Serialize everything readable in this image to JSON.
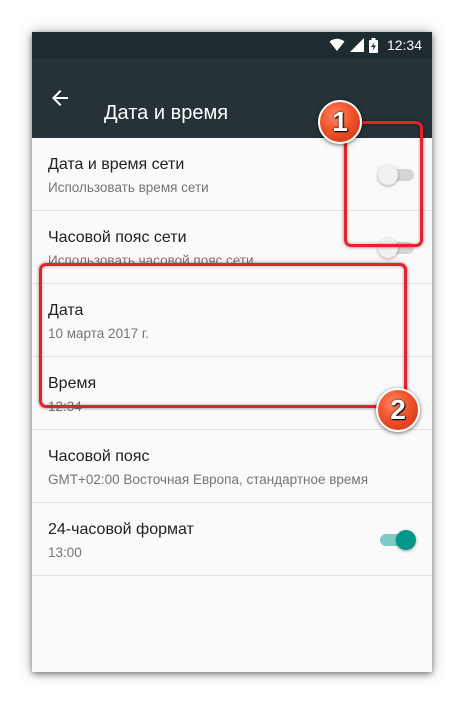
{
  "status_bar": {
    "time": "12:34"
  },
  "app_bar": {
    "title": "Дата и время"
  },
  "settings": [
    {
      "title": "Дата и время сети",
      "subtitle": "Использовать время сети",
      "toggle": "off"
    },
    {
      "title": "Часовой пояс сети",
      "subtitle": "Использовать часовой пояс сети",
      "toggle": "off"
    },
    {
      "title": "Дата",
      "subtitle": "10 марта 2017 г."
    },
    {
      "title": "Время",
      "subtitle": "12:34"
    },
    {
      "title": "Часовой пояс",
      "subtitle": "GMT+02:00 Восточная Европа, стандартное время"
    },
    {
      "title": "24-часовой формат",
      "subtitle": "13:00",
      "toggle": "on"
    }
  ],
  "annotations": {
    "badge_1": "1",
    "badge_2": "2"
  },
  "colors": {
    "appbar": "#263238",
    "statusbar": "#1f2b30",
    "accent": "#009688",
    "highlight": "#e8202a"
  }
}
